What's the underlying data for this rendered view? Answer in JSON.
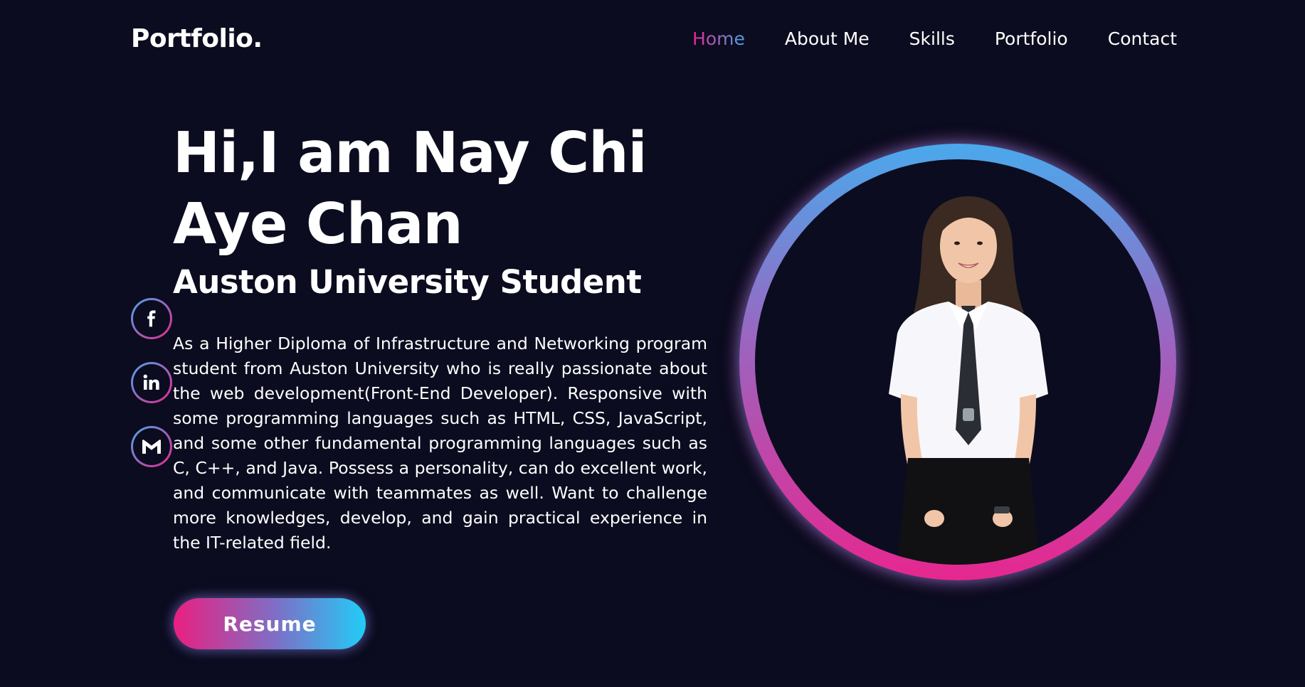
{
  "header": {
    "logo": "Portfolio.",
    "nav": [
      {
        "label": "Home",
        "active": true
      },
      {
        "label": "About Me",
        "active": false
      },
      {
        "label": "Skills",
        "active": false
      },
      {
        "label": "Portfolio",
        "active": false
      },
      {
        "label": "Contact",
        "active": false
      }
    ]
  },
  "hero": {
    "title": "Hi,I am Nay Chi Aye Chan",
    "subtitle": "Auston University Student",
    "description": "As a Higher Diploma of Infrastructure and Networking program student from Auston University who is really passionate about the web development(Front-End Developer). Responsive with some programming languages such as HTML, CSS, JavaScript, and some other fundamental programming languages such as C, C++, and Java. Possess a personality, can do excellent work, and communicate with teammates as well. Want to challenge more knowledges, develop, and gain practical experience in the IT-related field.",
    "resume_label": "Resume"
  },
  "social": [
    {
      "icon": "facebook-icon"
    },
    {
      "icon": "linkedin-icon"
    },
    {
      "icon": "gmail-icon"
    }
  ],
  "colors": {
    "background": "#0b0c1f",
    "accent_pink": "#e6278f",
    "accent_blue": "#4aa6ea",
    "accent_cyan": "#22ccf7"
  }
}
